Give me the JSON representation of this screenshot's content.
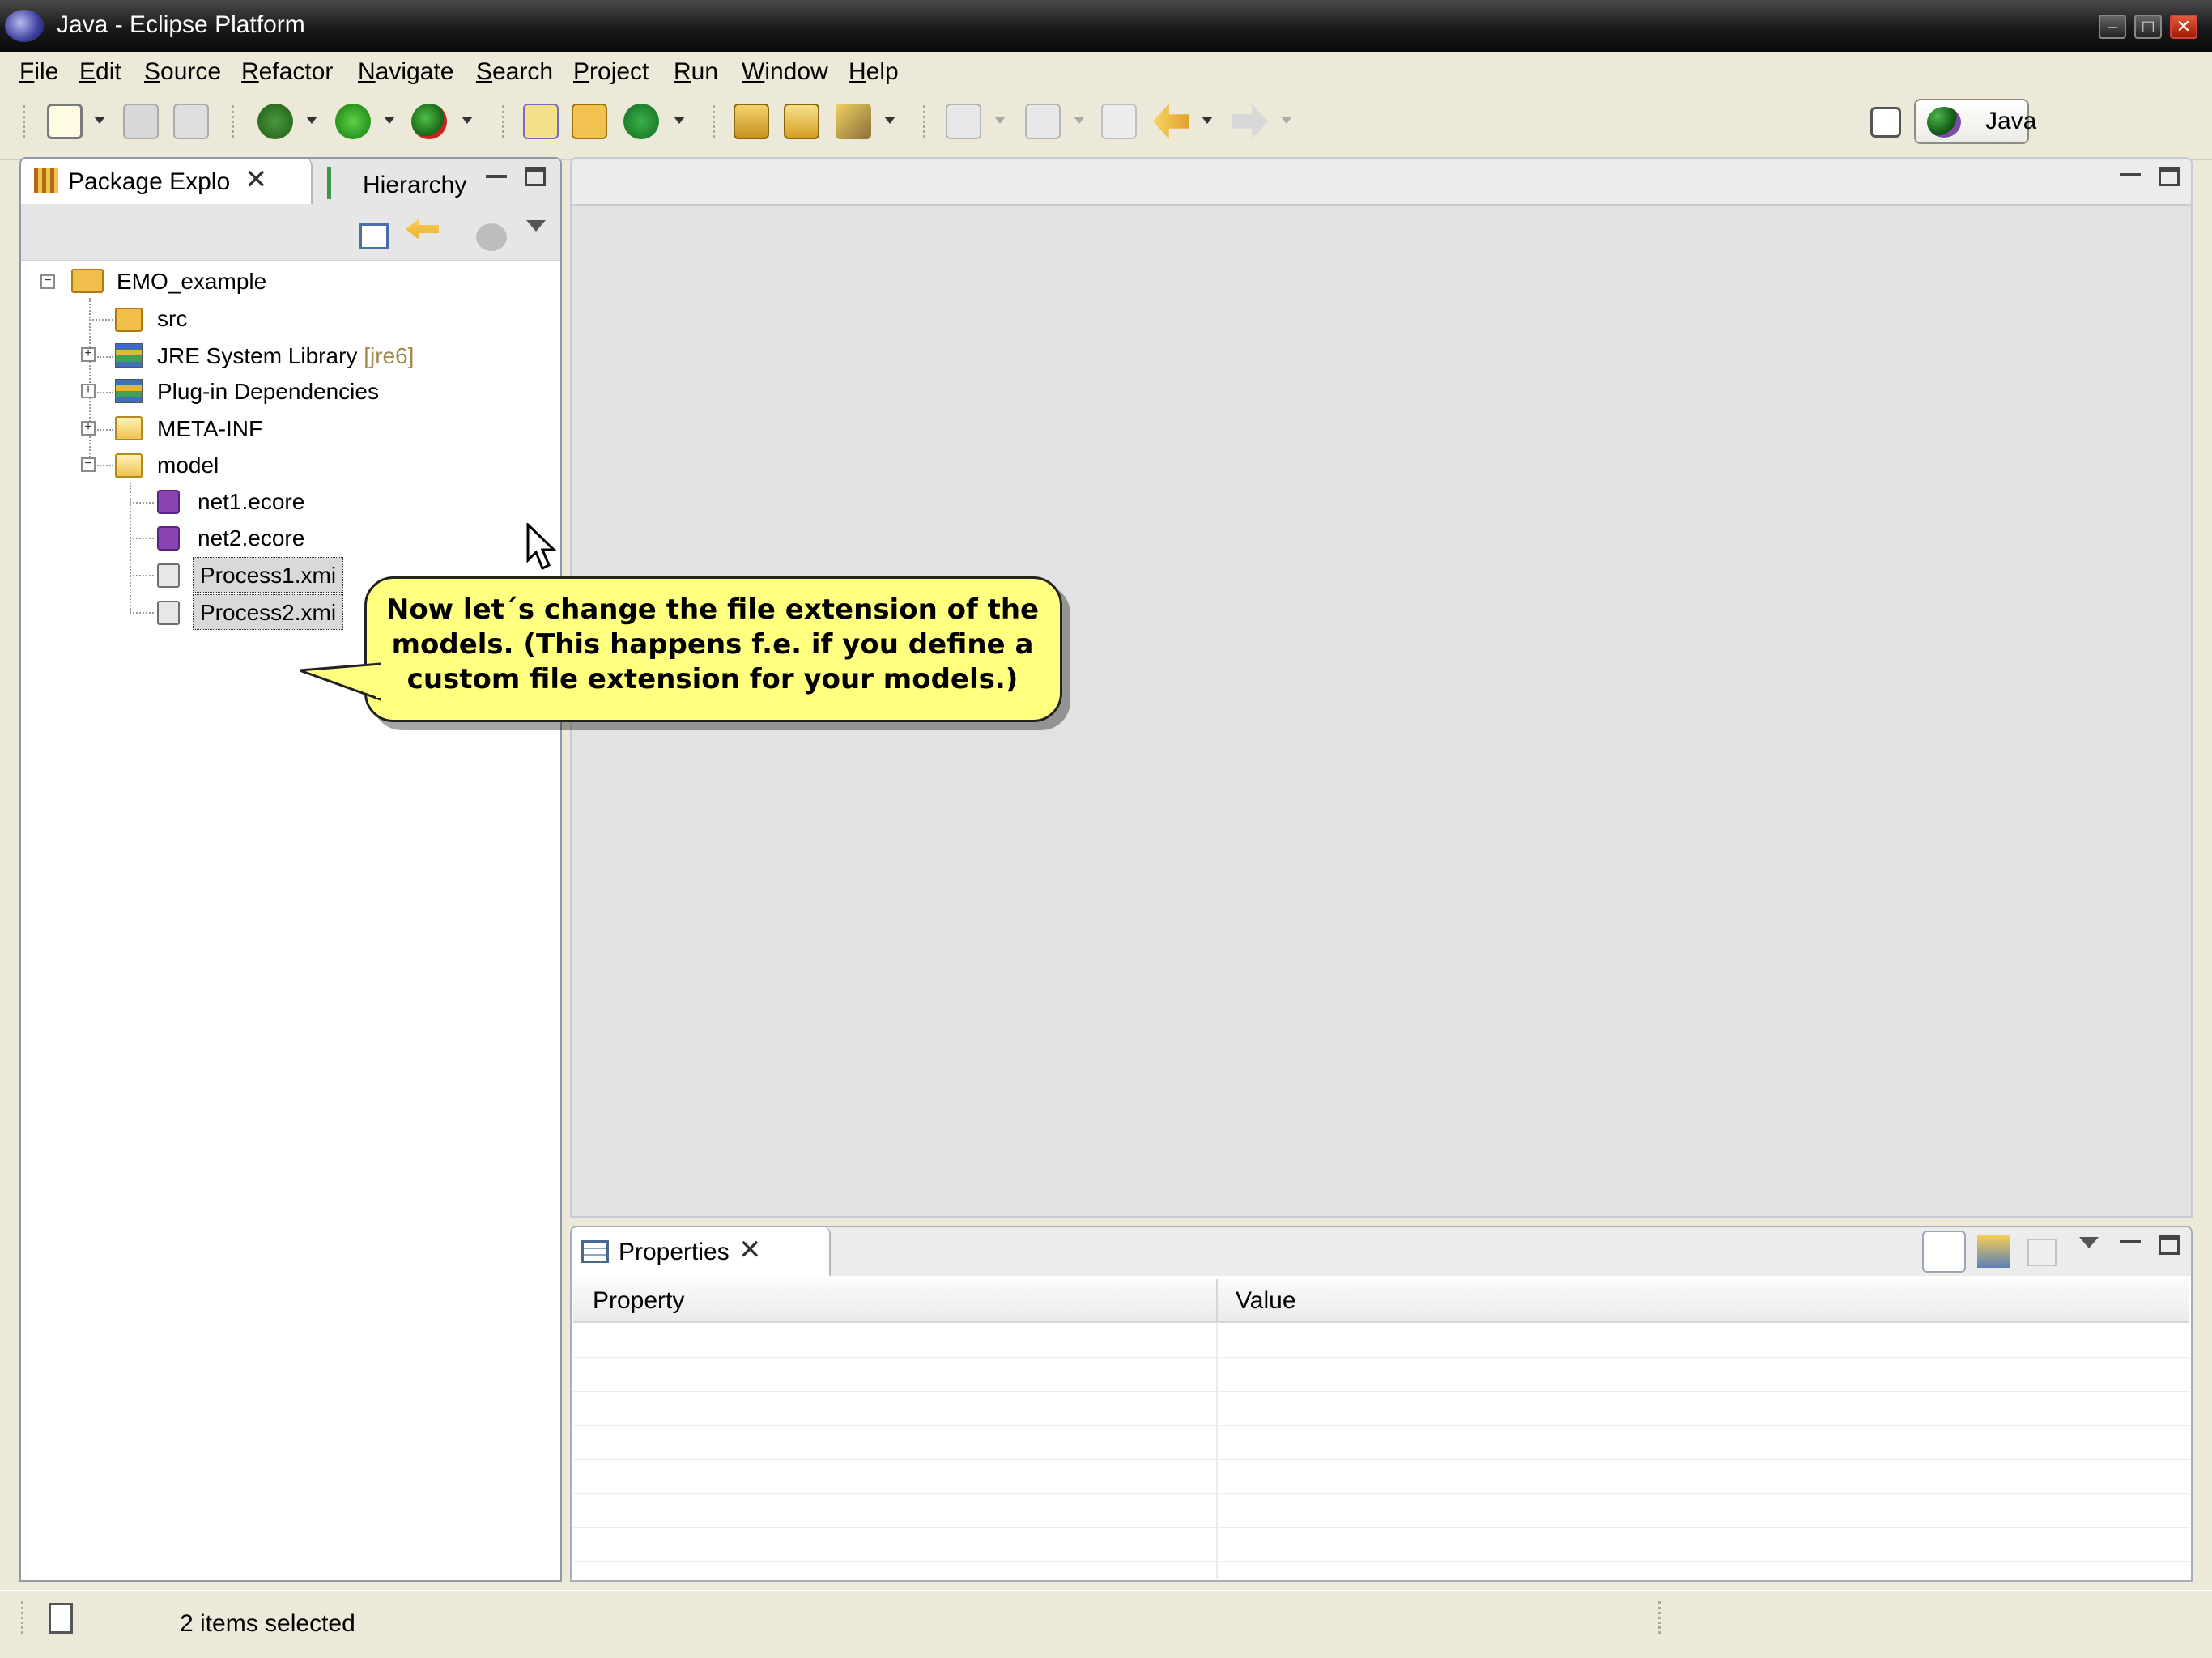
{
  "window": {
    "title": "Java - Eclipse Platform"
  },
  "menu": [
    "File",
    "Edit",
    "Source",
    "Refactor",
    "Navigate",
    "Search",
    "Project",
    "Run",
    "Window",
    "Help"
  ],
  "perspective": {
    "label": "Java"
  },
  "left_view": {
    "tabs": [
      {
        "label": "Package Explo"
      },
      {
        "label": "Hierarchy"
      }
    ],
    "tree": [
      {
        "label": "EMO_example"
      },
      {
        "label": "src"
      },
      {
        "label": "JRE System Library",
        "suffix": "[jre6]"
      },
      {
        "label": "Plug-in Dependencies"
      },
      {
        "label": "META-INF"
      },
      {
        "label": "model"
      },
      {
        "label": "net1.ecore"
      },
      {
        "label": "net2.ecore"
      },
      {
        "label": "Process1.xmi"
      },
      {
        "label": "Process2.xmi"
      }
    ]
  },
  "properties": {
    "tab": "Properties",
    "columns": [
      "Property",
      "Value"
    ]
  },
  "status": {
    "text": "2 items selected"
  },
  "callout": {
    "text": "Now let´s change the file extension of the models. (This happens f.e. if you define a custom file extension for your models.)"
  },
  "colors": {
    "callout_bg": "#ffff80",
    "frame": "#ece9d8",
    "editor": "#e2e2e2"
  }
}
